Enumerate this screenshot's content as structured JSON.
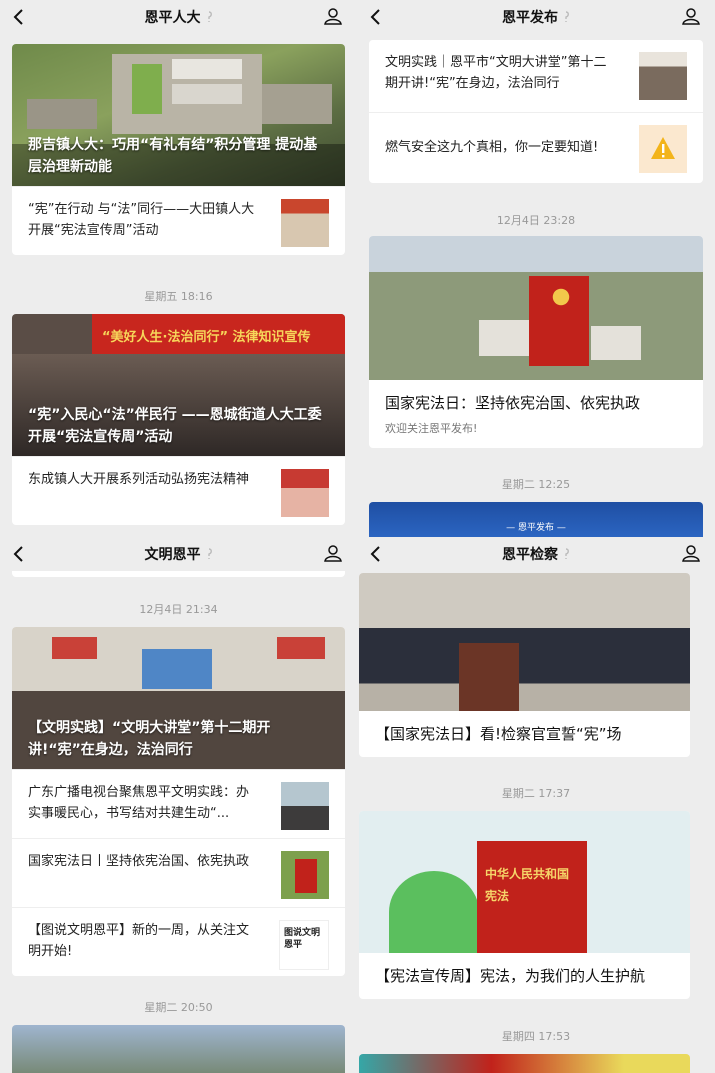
{
  "pane1": {
    "title": "恩平人大",
    "card1_caption": "那吉镇人大：巧用“有礼有结”积分管理 提动基层治理新动能",
    "card1_item": "“宪”在行动 与“法”同行——大田镇人大开展“宪法宣传周”活动",
    "stamp": "星期五 18:16",
    "card2_caption": "“宪”入民心“法”伴民行 ——恩城街道人大工委开展“宪法宣传周”活动",
    "card2_item": "东成镇人大开展系列活动弘扬宪法精神",
    "banner_text": "“美好人生·法治同行” 法律知识宣传"
  },
  "pane2": {
    "title": "恩平发布",
    "item1": "文明实践｜恩平市“文明大讲堂”第十二期开讲!“宪”在身边，法治同行",
    "item2": "燃气安全这九个真相，你一定要知道!",
    "stamp1": "12月4日 23:28",
    "card_title": "国家宪法日：坚持依宪治国、依宪执政",
    "card_sub": "欢迎关注恩平发布!",
    "stamp2": "星期二 12:25",
    "banner": "— 恩平发布 —"
  },
  "pane3": {
    "title": "文明恩平",
    "stamp1": "12月4日 21:34",
    "card_caption": "【文明实践】“文明大讲堂”第十二期开讲!“宪”在身边，法治同行",
    "item1": "广东广播电视台聚焦恩平文明实践：办实事暖民心，书写结对共建生动“...",
    "item2": "国家宪法日丨坚持依宪治国、依宪执政",
    "item3": "【图说文明恩平】新的一周，从关注文明开始!",
    "thumb3": "图说文明恩平",
    "stamp2": "星期二 20:50"
  },
  "pane4": {
    "title": "恩平检察",
    "card1_title": "【国家宪法日】看!检察官宣誓“宪”场",
    "stamp1": "星期二 17:37",
    "book_text": "中华人民共和国 宪法",
    "card2_title": "【宪法宣传周】宪法，为我们的人生护航",
    "stamp2": "星期四 17:53"
  },
  "colors": {
    "accent": "#c4161c",
    "bg": "#ededed"
  }
}
